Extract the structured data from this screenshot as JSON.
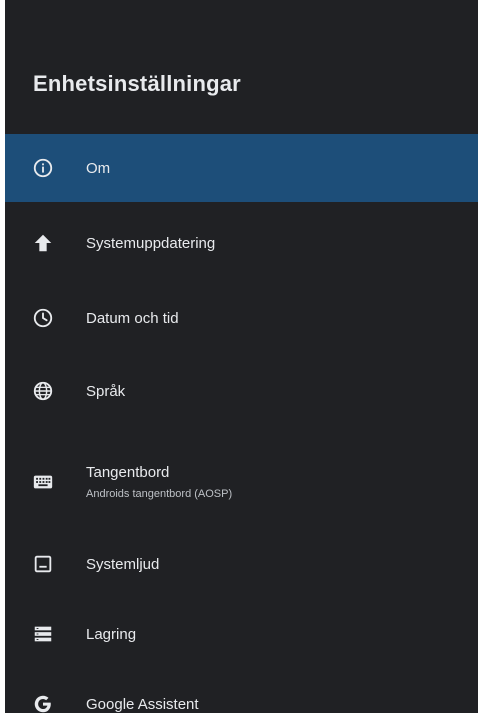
{
  "screen": {
    "title": "Enhetsinställningar"
  },
  "colors": {
    "background": "#202124",
    "selected": "#1d4e79",
    "text": "#e8eaed"
  },
  "menu": {
    "items": [
      {
        "label": "Om",
        "icon": "info-icon",
        "selected": true
      },
      {
        "label": "Systemuppdatering",
        "icon": "arrow-up-icon"
      },
      {
        "label": "Datum och tid",
        "icon": "clock-icon"
      },
      {
        "label": "Språk",
        "icon": "globe-icon"
      },
      {
        "label": "Tangentbord",
        "sublabel": "Androids tangentbord (AOSP)",
        "icon": "keyboard-icon"
      },
      {
        "label": "Systemljud",
        "icon": "image-icon"
      },
      {
        "label": "Lagring",
        "icon": "storage-icon"
      },
      {
        "label": "Google Assistent",
        "icon": "google-icon"
      }
    ]
  }
}
